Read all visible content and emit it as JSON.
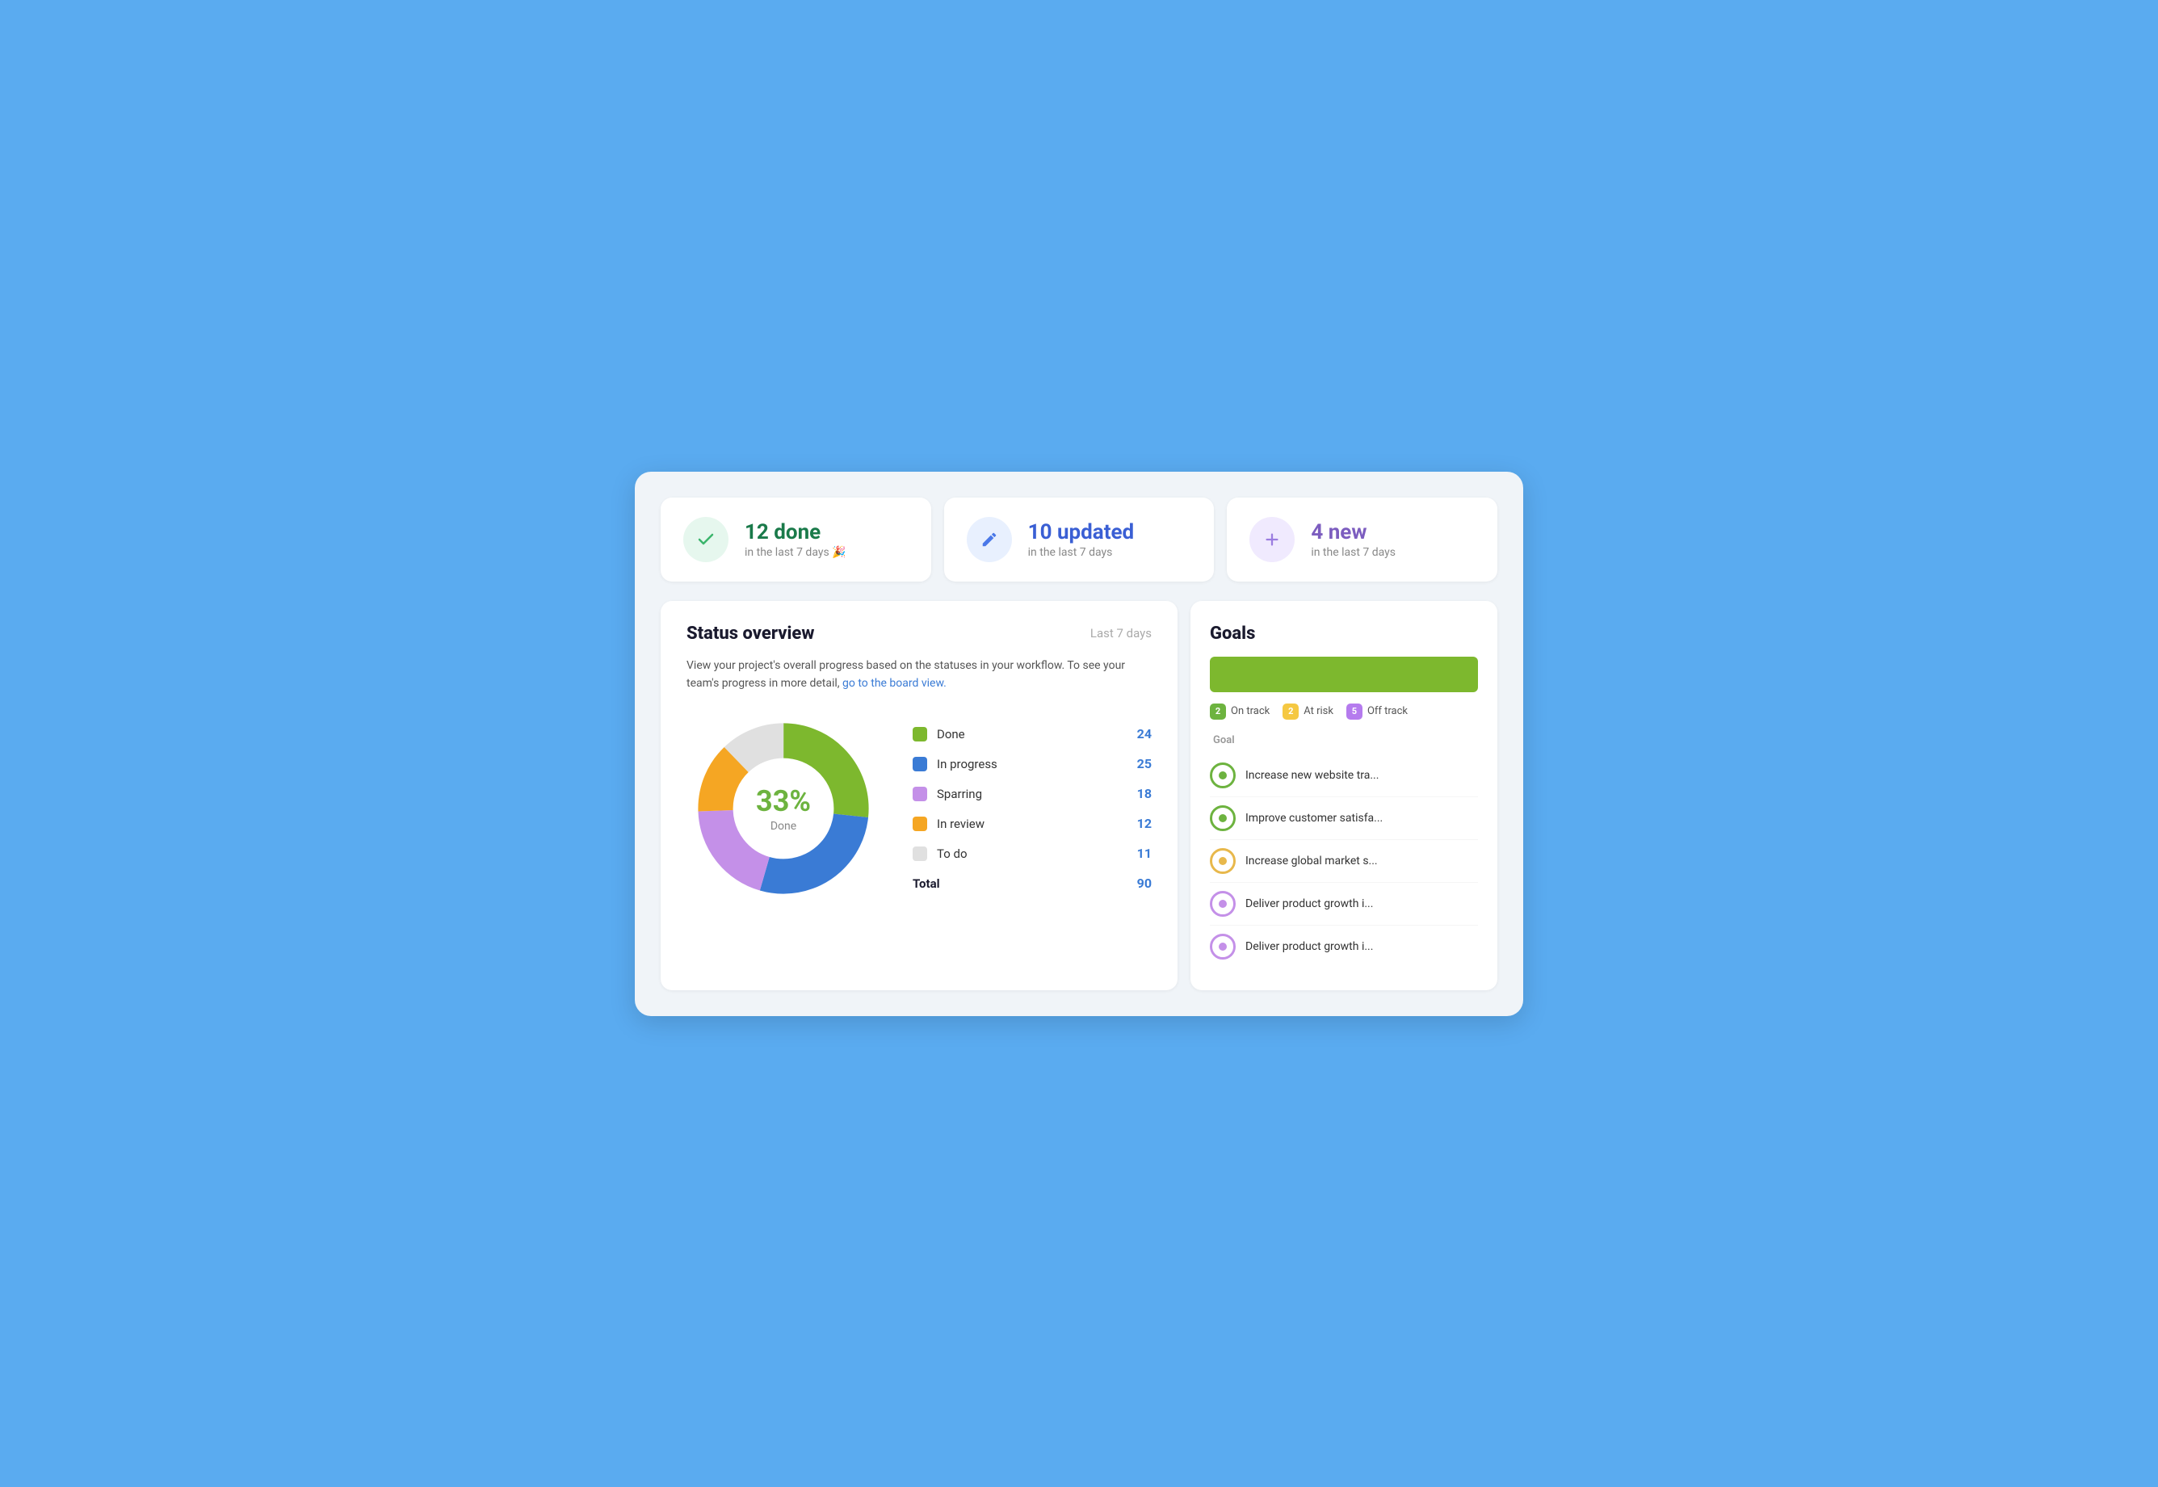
{
  "stat_cards": [
    {
      "icon_type": "check",
      "icon_class": "green",
      "number": "12 done",
      "sub": "in the last 7 days 🎉",
      "number_color": "#1a7a4a"
    },
    {
      "icon_type": "pencil",
      "icon_class": "blue",
      "number": "10 updated",
      "sub": "in the last 7 days",
      "number_color": "#3a5fd4"
    },
    {
      "icon_type": "plus",
      "icon_class": "purple",
      "number": "4 new",
      "sub": "in the last 7 days",
      "number_color": "#7c5dbf"
    }
  ],
  "status_overview": {
    "title": "Status overview",
    "time_label": "Last 7 days",
    "description": "View your project's overall progress based on the statuses in your workflow. To see your team's progress in more detail,",
    "link_text": "go to the board view.",
    "center_percent": "33%",
    "center_label": "Done",
    "legend": [
      {
        "name": "Done",
        "value": "24",
        "color": "#7db82e"
      },
      {
        "name": "In progress",
        "value": "25",
        "color": "#3a7bd5"
      },
      {
        "name": "Sparring",
        "value": "18",
        "color": "#c490e8"
      },
      {
        "name": "In review",
        "value": "12",
        "color": "#f5a623"
      },
      {
        "name": "To do",
        "value": "11",
        "color": "#e0e0e0"
      }
    ],
    "total_label": "Total",
    "total_value": "90"
  },
  "goals": {
    "title": "Goals",
    "bar_color": "#7db82e",
    "legend": [
      {
        "count": "2",
        "label": "On track",
        "badge_class": "badge-green"
      },
      {
        "count": "2",
        "label": "At risk",
        "badge_class": "badge-yellow"
      },
      {
        "count": "5",
        "label": "Off track",
        "badge_class": "badge-purple"
      }
    ],
    "column_header": "Goal",
    "items": [
      {
        "name": "Increase new website tra...",
        "icon_class": "green-target"
      },
      {
        "name": "Improve customer satisfa...",
        "icon_class": "green-target"
      },
      {
        "name": "Increase global market s...",
        "icon_class": "yellow-target"
      },
      {
        "name": "Deliver product growth i...",
        "icon_class": "light-purple-target"
      },
      {
        "name": "Deliver product growth i...",
        "icon_class": "light-purple-target"
      }
    ]
  }
}
